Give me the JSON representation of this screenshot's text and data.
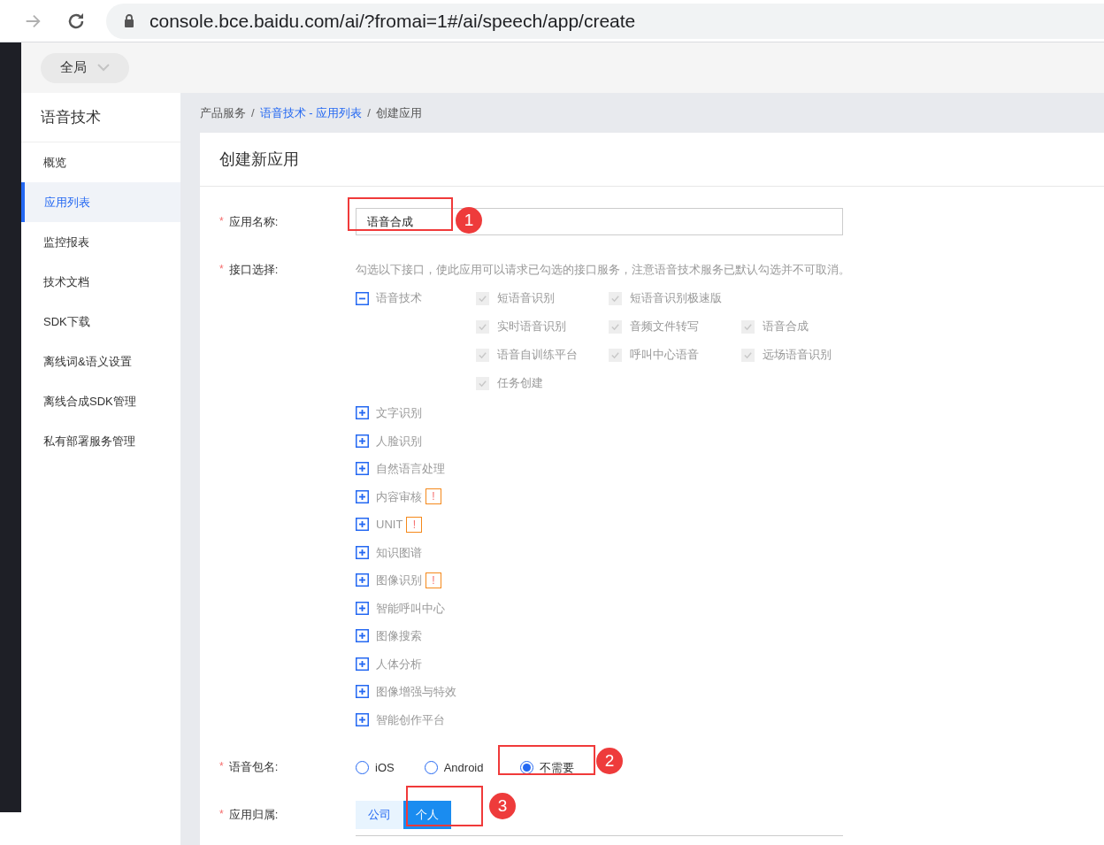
{
  "browser": {
    "url": "console.bce.baidu.com/ai/?fromai=1#/ai/speech/app/create"
  },
  "top_bar": {
    "scope": "全局"
  },
  "sidebar": {
    "title": "语音技术",
    "items": [
      {
        "label": "概览",
        "selected": false
      },
      {
        "label": "应用列表",
        "selected": true
      },
      {
        "label": "监控报表",
        "selected": false
      },
      {
        "label": "技术文档",
        "selected": false
      },
      {
        "label": "SDK下载",
        "selected": false
      },
      {
        "label": "离线词&语义设置",
        "selected": false
      },
      {
        "label": "离线合成SDK管理",
        "selected": false
      },
      {
        "label": "私有部署服务管理",
        "selected": false
      }
    ]
  },
  "breadcrumb": [
    {
      "label": "产品服务",
      "link": false
    },
    {
      "label": "语音技术 - 应用列表",
      "link": true
    },
    {
      "label": "创建应用",
      "link": false
    }
  ],
  "breadcrumb_separator": "/",
  "form": {
    "title": "创建新应用",
    "app_name": {
      "required_mark": "*",
      "label": "应用名称:",
      "value": "语音合成"
    },
    "interfaces": {
      "required_mark": "*",
      "label": "接口选择:",
      "hint": "勾选以下接口，使此应用可以请求已勾选的接口服务，注意语音技术服务已默认勾选并不可取消。",
      "groups": [
        {
          "label": "语音技术",
          "expanded": true,
          "children": [
            {
              "label": "短语音识别",
              "checked": true,
              "disabled": true
            },
            {
              "label": "短语音识别极速版",
              "checked": true,
              "disabled": true
            },
            {
              "label": "实时语音识别",
              "checked": true,
              "disabled": true
            },
            {
              "label": "音频文件转写",
              "checked": true,
              "disabled": true
            },
            {
              "label": "语音合成",
              "checked": true,
              "disabled": true
            },
            {
              "label": "语音自训练平台",
              "checked": true,
              "disabled": true
            },
            {
              "label": "呼叫中心语音",
              "checked": true,
              "disabled": true
            },
            {
              "label": "远场语音识别",
              "checked": true,
              "disabled": true
            },
            {
              "label": "任务创建",
              "checked": true,
              "disabled": true
            }
          ]
        },
        {
          "label": "文字识别",
          "expanded": false
        },
        {
          "label": "人脸识别",
          "expanded": false
        },
        {
          "label": "自然语言处理",
          "expanded": false
        },
        {
          "label": "内容审核",
          "expanded": false,
          "badge": "!"
        },
        {
          "label": "UNIT",
          "expanded": false,
          "badge": "!"
        },
        {
          "label": "知识图谱",
          "expanded": false
        },
        {
          "label": "图像识别",
          "expanded": false,
          "badge": "!"
        },
        {
          "label": "智能呼叫中心",
          "expanded": false
        },
        {
          "label": "图像搜索",
          "expanded": false
        },
        {
          "label": "人体分析",
          "expanded": false
        },
        {
          "label": "图像增强与特效",
          "expanded": false
        },
        {
          "label": "智能创作平台",
          "expanded": false
        }
      ]
    },
    "package": {
      "required_mark": "*",
      "label": "语音包名:",
      "options": [
        {
          "label": "iOS",
          "selected": false
        },
        {
          "label": "Android",
          "selected": false
        },
        {
          "label": "不需要",
          "selected": true
        }
      ]
    },
    "ownership": {
      "required_mark": "*",
      "label": "应用归属:",
      "options": [
        {
          "label": "公司",
          "selected": false
        },
        {
          "label": "个人",
          "selected": true
        }
      ]
    }
  },
  "annotations": [
    {
      "label": "1"
    },
    {
      "label": "2"
    },
    {
      "label": "3"
    }
  ]
}
